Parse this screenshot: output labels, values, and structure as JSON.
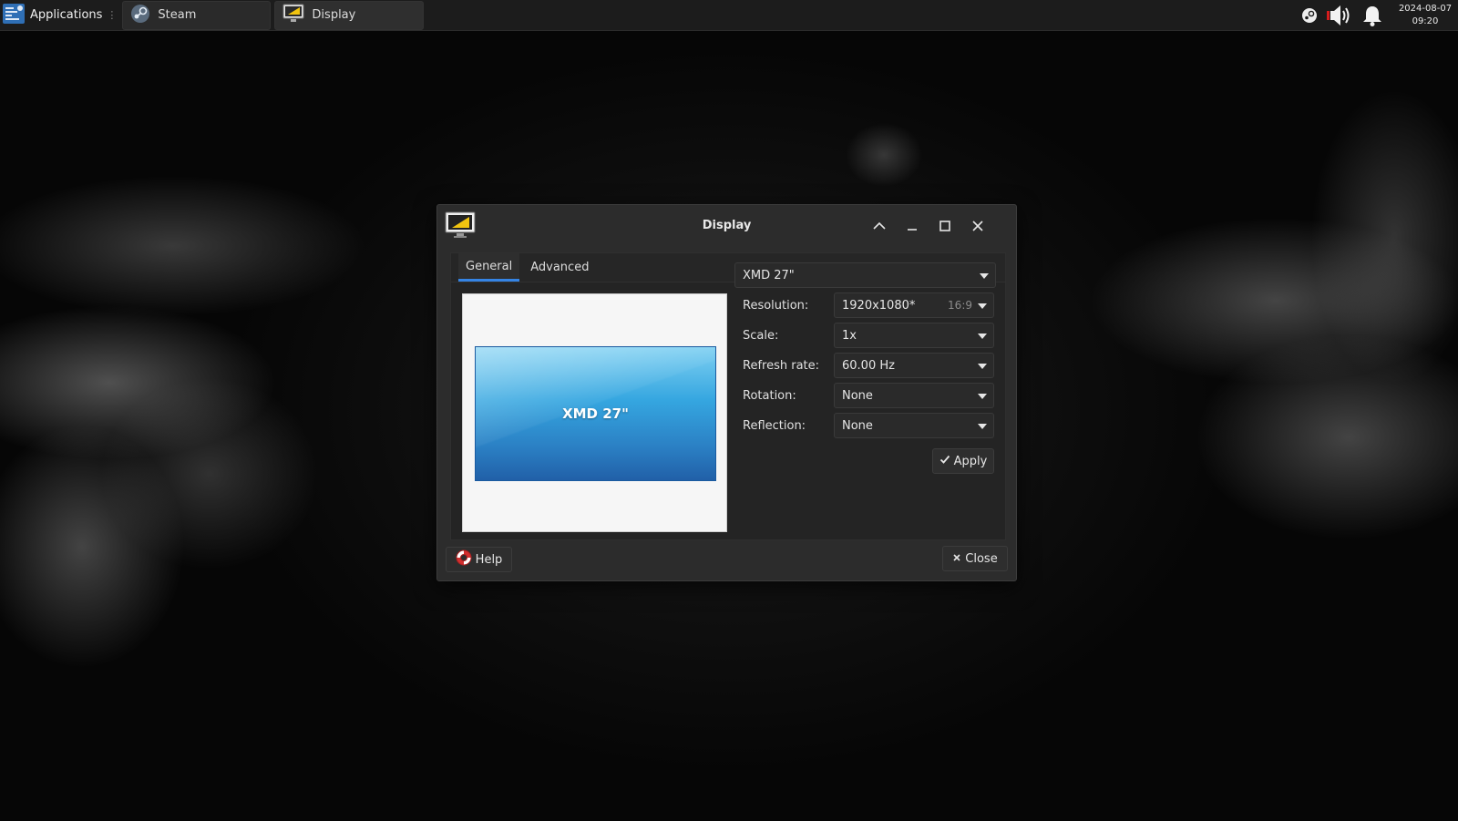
{
  "panel": {
    "applications_label": "Applications",
    "tasks": [
      {
        "label": "Steam",
        "icon": "steam-icon"
      },
      {
        "label": "Display",
        "icon": "display-icon"
      }
    ],
    "clock": {
      "date": "2024-08-07",
      "time": "09:20"
    },
    "tray_icons": [
      "steam-tray-icon",
      "volume-icon",
      "notification-bell-icon"
    ]
  },
  "dialog": {
    "title": "Display",
    "tabs": [
      "General",
      "Advanced"
    ],
    "active_tab": "General",
    "monitor_name": "XMD 27\"",
    "display_select": "XMD 27\"",
    "fields": {
      "resolution": {
        "label": "Resolution:",
        "value": "1920x1080*",
        "aspect": "16:9"
      },
      "scale": {
        "label": "Scale:",
        "value": "1x"
      },
      "refresh_rate": {
        "label": "Refresh rate:",
        "value": "60.00 Hz"
      },
      "rotation": {
        "label": "Rotation:",
        "value": "None"
      },
      "reflection": {
        "label": "Reflection:",
        "value": "None"
      }
    },
    "apply_label": "Apply",
    "help_label": "Help",
    "close_label": "Close"
  },
  "colors": {
    "accent": "#3584e4",
    "panel_bg": "#1c1c1c",
    "dialog_bg": "#2c2c2c",
    "monitor_top": "#7fd0f2",
    "monitor_bottom": "#2160a8"
  }
}
